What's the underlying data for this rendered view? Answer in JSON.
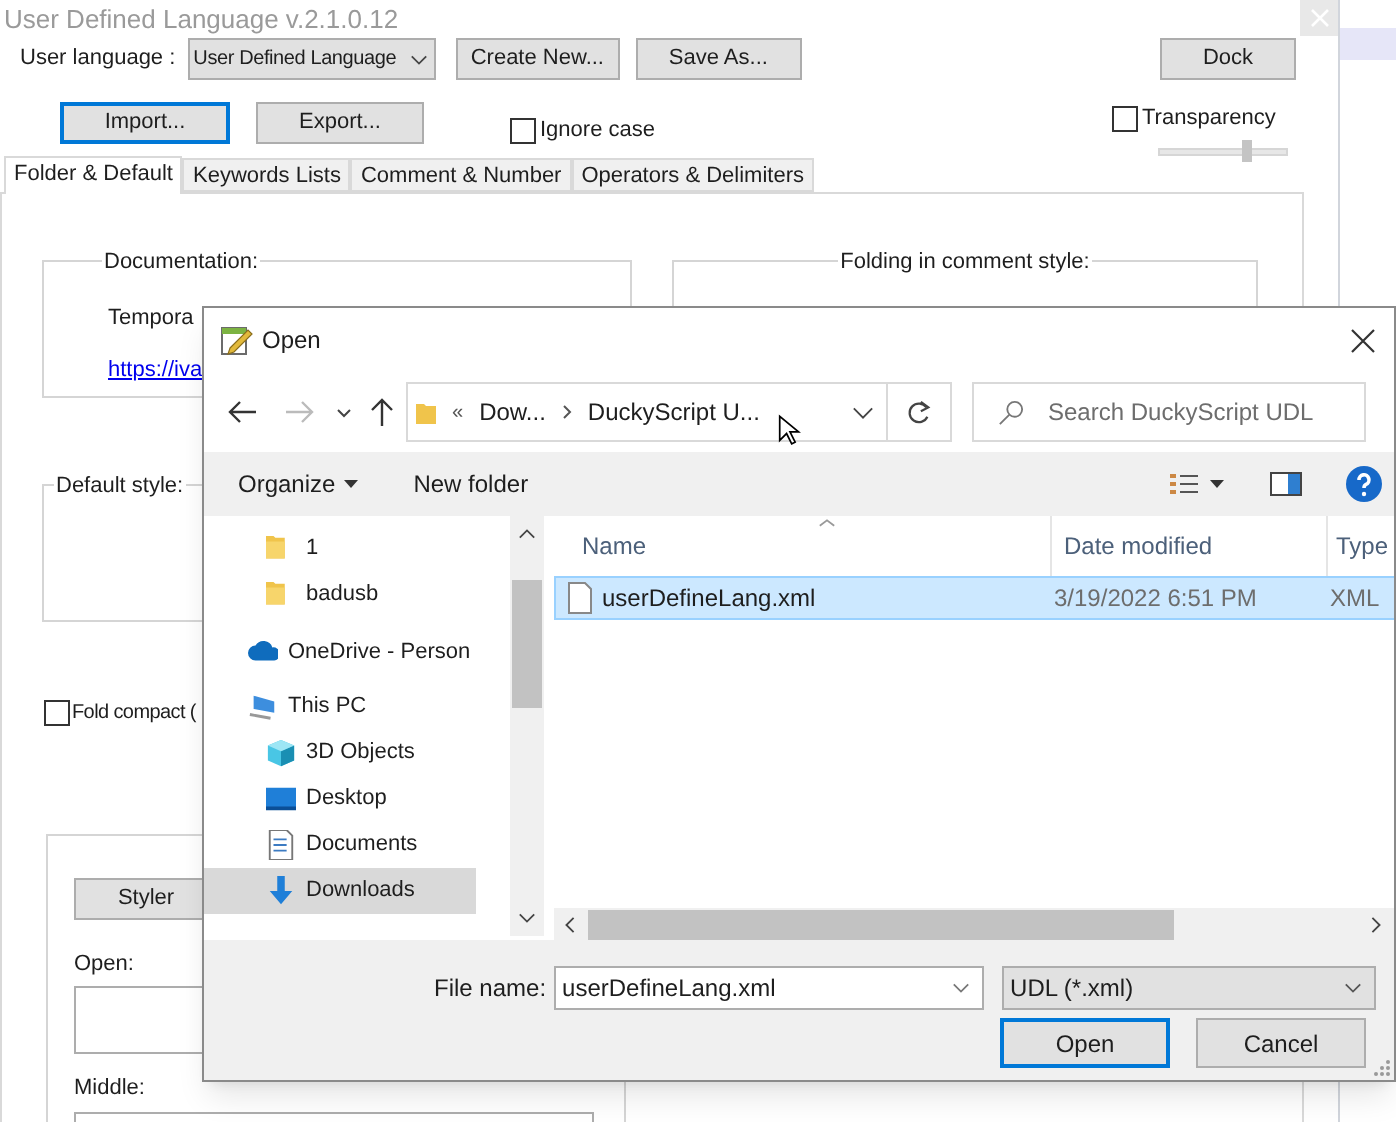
{
  "window": {
    "title": "User Defined Language v.2.1.0.12"
  },
  "language": {
    "label": "User language :",
    "value": "User Defined Language"
  },
  "top_buttons": [
    "Create New...",
    "Save As...",
    "Dock"
  ],
  "import_button": {
    "label": "Import...",
    "focused": true
  },
  "export_button": {
    "label": "Export...",
    "focused": false
  },
  "ignore_case": {
    "label": "Ignore case",
    "checked": false
  },
  "transparency": {
    "label": "Transparency",
    "checked": false,
    "level": 0.69
  },
  "tabs": [
    {
      "label": "Folder & Default",
      "selected": true
    },
    {
      "label": "Keywords Lists",
      "selected": false
    },
    {
      "label": "Comment & Number",
      "selected": false
    },
    {
      "label": "Operators & Delimiters",
      "selected": false
    }
  ],
  "documentation": {
    "title": "Documentation:",
    "text": "Tempora",
    "link": "https://iva"
  },
  "folding_in_comment_style": {
    "title": "Folding in comment style:"
  },
  "default_style": {
    "title": "Default style:"
  },
  "fold_compact": {
    "label": "Fold compact (",
    "checked": false
  },
  "styler_button": "Styler",
  "open_label": "Open:",
  "middle_label": "Middle:",
  "dialog": {
    "title": "Open",
    "address": [
      "«",
      "Dow...",
      "DuckyScript U..."
    ],
    "search_placeholder": "Search DuckyScript UDL",
    "toolbar": [
      "Organize",
      "New folder"
    ],
    "nav_tree": [
      {
        "children": [
          {
            "kind": "folder",
            "label": "1",
            "selected": false
          },
          {
            "kind": "folder",
            "label": "badusb",
            "selected": false
          }
        ]
      },
      {
        "kind": "cloud",
        "label": "OneDrive - Person",
        "selected": false
      },
      {
        "kind": "pc",
        "label": "This PC",
        "selected": false,
        "children": [
          {
            "kind": "cube",
            "label": "3D Objects",
            "selected": false
          },
          {
            "kind": "desktop",
            "label": "Desktop",
            "selected": false
          },
          {
            "kind": "document",
            "label": "Documents",
            "selected": false
          },
          {
            "kind": "download",
            "label": "Downloads",
            "selected": true
          }
        ]
      }
    ],
    "columns": [
      "Name",
      "Date modified",
      "Type"
    ],
    "files": [
      {
        "name": "userDefineLang.xml",
        "date": "3/19/2022 6:51 PM",
        "type": "XML",
        "selected": true
      }
    ],
    "file_name_label": "File name:",
    "file_name": "userDefineLang.xml",
    "filter": "UDL (*.xml)",
    "buttons": [
      {
        "label": "Open",
        "default": true
      },
      {
        "label": "Cancel",
        "default": false
      }
    ]
  }
}
